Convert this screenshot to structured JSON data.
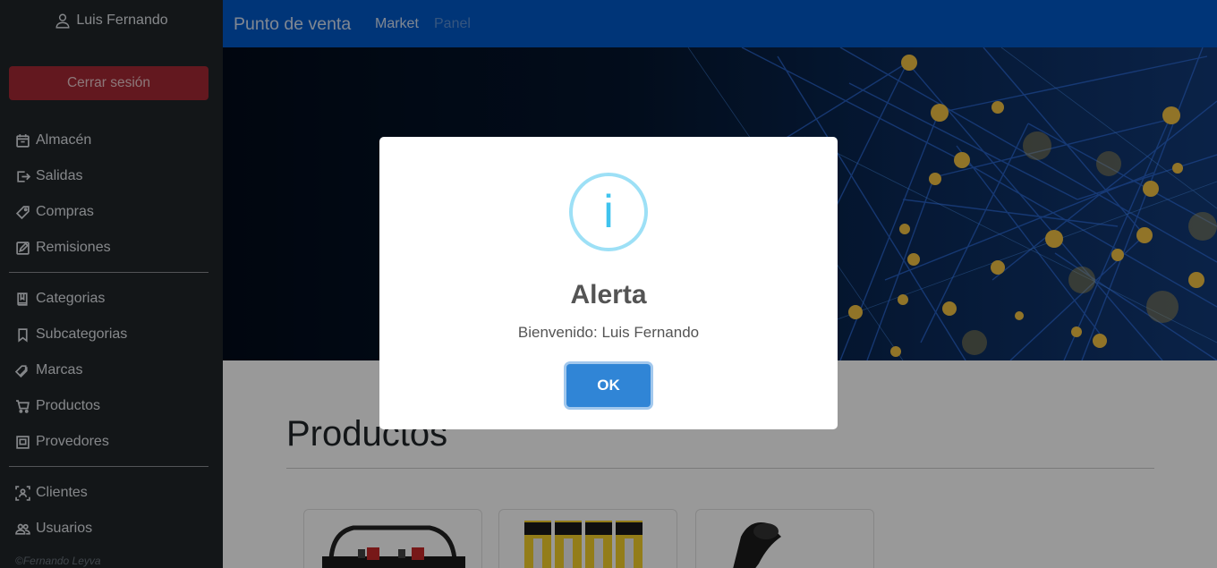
{
  "sidebar": {
    "user_name": "Luis Fernando",
    "logout_label": "Cerrar sesión",
    "group1": [
      {
        "label": "Almacén",
        "icon": "calendar-box-icon"
      },
      {
        "label": "Salidas",
        "icon": "exit-box-icon"
      },
      {
        "label": "Compras",
        "icon": "tag-icon"
      },
      {
        "label": "Remisiones",
        "icon": "edit-box-icon"
      }
    ],
    "group2": [
      {
        "label": "Categorias",
        "icon": "book-icon"
      },
      {
        "label": "Subcategorias",
        "icon": "bookmark-icon"
      },
      {
        "label": "Marcas",
        "icon": "tags-icon"
      },
      {
        "label": "Productos",
        "icon": "cart-icon"
      },
      {
        "label": "Provedores",
        "icon": "vendor-box-icon"
      }
    ],
    "group3": [
      {
        "label": "Clientes",
        "icon": "person-scan-icon"
      },
      {
        "label": "Usuarios",
        "icon": "people-icon"
      }
    ],
    "footer": "©Fernando Leyva"
  },
  "topbar": {
    "brand": "Punto de venta",
    "links": [
      "Market",
      "Panel"
    ]
  },
  "main": {
    "heading": "Productos"
  },
  "modal": {
    "icon": "info-icon",
    "icon_glyph": "i",
    "title": "Alerta",
    "text": "Bienvenido: Luis Fernando",
    "ok_label": "OK"
  },
  "colors": {
    "sidebar_bg": "#212529",
    "topbar_bg": "#0059c8",
    "logout_bg": "#a52834",
    "ok_button": "#3085d6",
    "info_icon": "#3fc3ee"
  }
}
